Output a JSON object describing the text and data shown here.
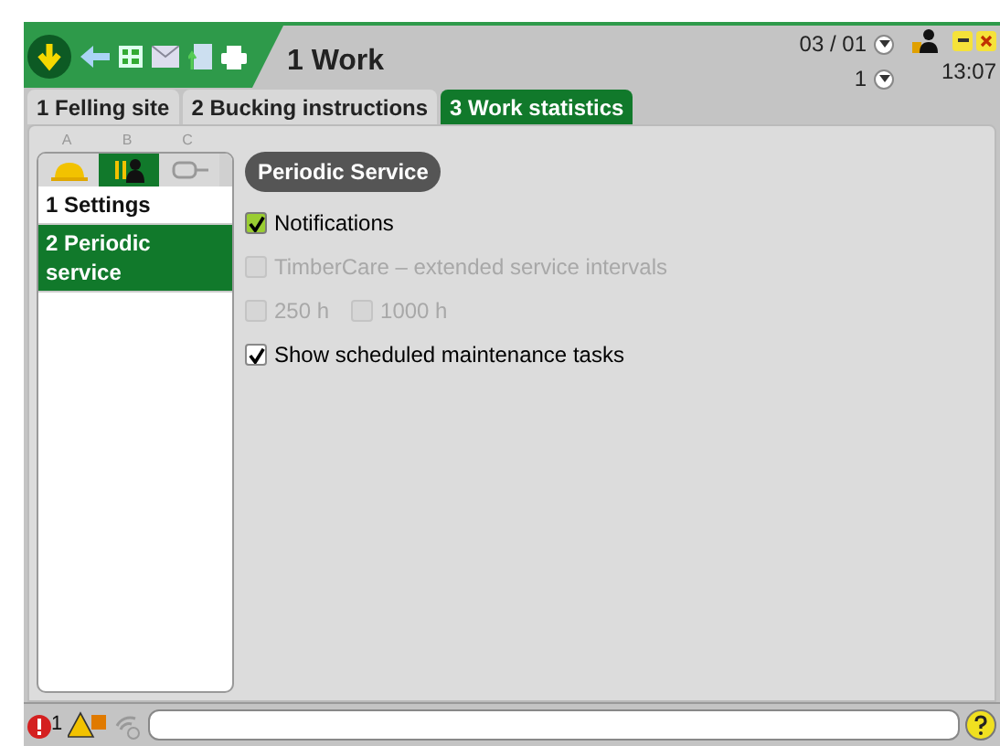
{
  "header": {
    "title": "1 Work",
    "date": "03 / 01",
    "shift": "1",
    "time": "13:07"
  },
  "tabs": [
    {
      "label": "1 Felling site",
      "selected": false
    },
    {
      "label": "2 Bucking instructions",
      "selected": false
    },
    {
      "label": "3 Work statistics",
      "selected": true
    }
  ],
  "sidebar": {
    "tabs": [
      {
        "letter": "A",
        "kind": "helmet",
        "selected": false
      },
      {
        "letter": "B",
        "kind": "operator",
        "selected": true
      },
      {
        "letter": "C",
        "kind": "plug",
        "selected": false
      }
    ],
    "items": [
      {
        "label": "1 Settings",
        "selected": false
      },
      {
        "label": "2 Periodic service",
        "selected": true
      }
    ]
  },
  "section": {
    "title": "Periodic Service",
    "rows": [
      [
        {
          "label": "Notifications",
          "kind": "accent",
          "checked": true,
          "disabled": false
        }
      ],
      [
        {
          "label": "TimberCare – extended service intervals",
          "kind": "plain",
          "checked": false,
          "disabled": true
        }
      ],
      [
        {
          "label": "250 h",
          "kind": "plain",
          "checked": false,
          "disabled": true
        },
        {
          "label": "1000 h",
          "kind": "plain",
          "checked": false,
          "disabled": true
        }
      ],
      [
        {
          "label": "Show scheduled maintenance tasks",
          "kind": "plain",
          "checked": true,
          "disabled": false
        }
      ]
    ]
  },
  "status_bar": {
    "error_count": "1"
  }
}
